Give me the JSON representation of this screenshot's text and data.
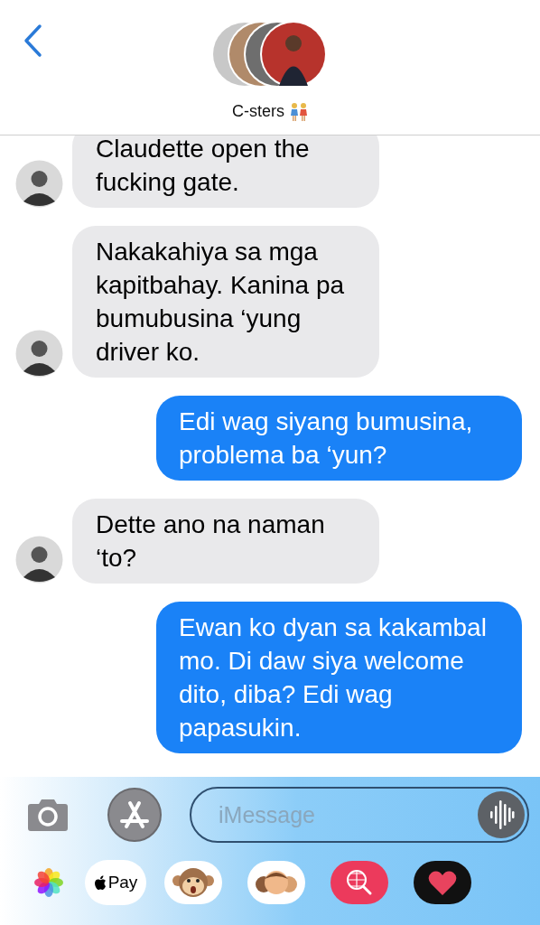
{
  "header": {
    "title": "C-sters"
  },
  "messages": [
    {
      "kind": "received",
      "text": "Claudette open the fucking gate."
    },
    {
      "kind": "received",
      "text": "Nakakahiya sa mga kapitbahay. Kanina pa bumubusina ‘yung driver ko."
    },
    {
      "kind": "sent",
      "text": "Edi wag siyang bumusina, problema ba ‘yun?"
    },
    {
      "kind": "received",
      "text": "Dette ano na naman ‘to?"
    },
    {
      "kind": "sent",
      "text": "Ewan ko dyan sa kakambal mo. Di daw siya welcome dito, diba? Edi wag papasukin."
    }
  ],
  "composer": {
    "placeholder": "iMessage"
  },
  "apps": {
    "pay_label": "Pay"
  }
}
